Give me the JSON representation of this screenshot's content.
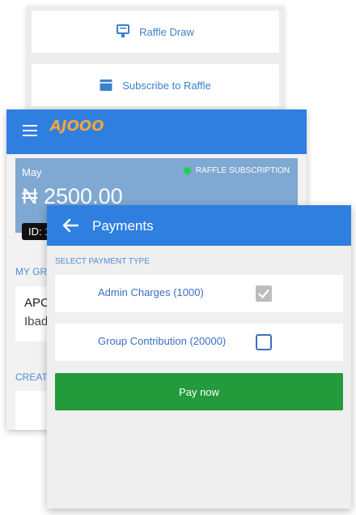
{
  "raffle_menu": {
    "raffle_draw_label": "Raffle Draw",
    "subscribe_label": "Subscribe to Raffle"
  },
  "app": {
    "logo_text": "AJOOO",
    "summary": {
      "month": "May",
      "subscription_status": "RAFFLE SUBSCRIPTION",
      "amount": "₦ 2500.00",
      "id_label": "ID: 1"
    },
    "my_groups_label": "MY GRO",
    "group": {
      "name": "APC",
      "location": "Ibad"
    },
    "create_label": "CREATI"
  },
  "payments": {
    "title": "Payments",
    "select_label": "SELECT PAYMENT TYPE",
    "options": [
      {
        "label": "Admin Charges (1000)",
        "checked": true,
        "disabled": true
      },
      {
        "label": "Group Contribution (20000)",
        "checked": false,
        "disabled": false
      }
    ],
    "pay_button_label": "Pay now"
  },
  "colors": {
    "app_bar": "#2f7fe0",
    "pay_button": "#239a3b",
    "status_dot": "#1ed34b",
    "accent_text": "#4f8ed4"
  }
}
